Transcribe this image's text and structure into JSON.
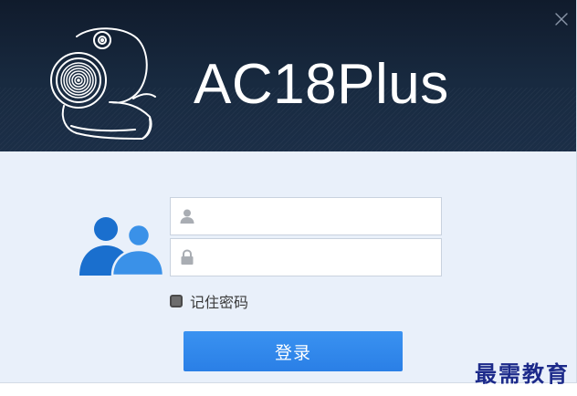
{
  "app": {
    "title": "AC18Plus"
  },
  "login_form": {
    "username_value": "",
    "password_value": "",
    "remember_label": "记住密码",
    "remember_checked": false,
    "login_label": "登录"
  },
  "icons": {
    "close": "close-icon",
    "logo": "webcam-icon",
    "users": "users-icon",
    "username_field": "user-icon",
    "password_field": "lock-icon"
  },
  "watermark": {
    "text": "最需教育"
  },
  "colors": {
    "banner": "#14233a",
    "background": "#e9f0fa",
    "accent": "#2f86ec",
    "users_icon_dark": "#1a6fce",
    "users_icon_light": "#3a91e8",
    "watermark": "#1c2a8a"
  }
}
